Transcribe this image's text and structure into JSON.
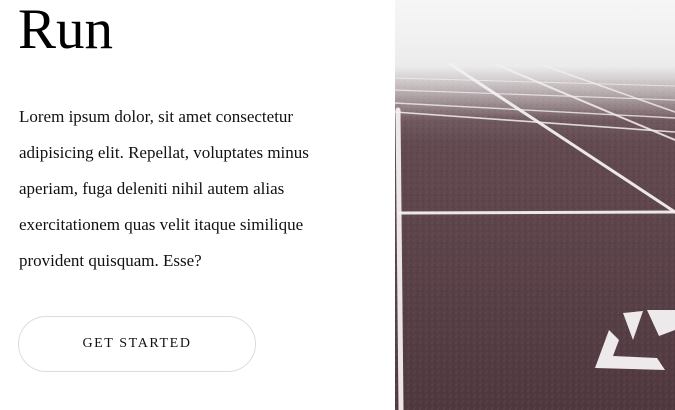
{
  "hero": {
    "title": "Run",
    "description": "Lorem ipsum dolor, sit amet consectetur adipisicing elit. Repellat, voluptates minus aperiam, fuga deleniti nihil autem alias exercitationem quas velit itaque similique provident quisquam. Esse?",
    "cta_label": "GET STARTED"
  },
  "image": {
    "subject": "running-track-photo",
    "colors": {
      "track": "#5a4147",
      "fog": "#f2f2f2",
      "lines": "#f4f4f4"
    }
  }
}
